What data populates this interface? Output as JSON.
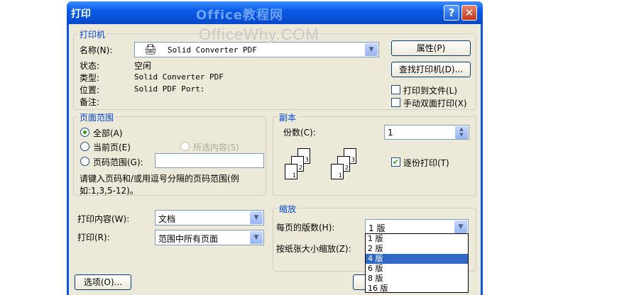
{
  "window": {
    "title": "打印",
    "help": "?",
    "close": "✕"
  },
  "watermark": {
    "top": "Office教程网",
    "bottom": "OfficeWhy.COM"
  },
  "printer": {
    "group_label": "打印机",
    "name_label": "名称(N):",
    "name_value": "Solid Converter PDF",
    "status_label": "状态:",
    "status_value": "空闲",
    "type_label": "类型:",
    "type_value": "Solid Converter PDF",
    "where_label": "位置:",
    "where_value": "Solid PDF Port:",
    "comment_label": "备注:",
    "comment_value": "",
    "properties_button": "属性(P)",
    "find_button": "查找打印机(D)...",
    "print_to_file": "打印到文件(L)",
    "manual_duplex": "手动双面打印(X)"
  },
  "page_range": {
    "group_label": "页面范围",
    "all": "全部(A)",
    "current": "当前页(E)",
    "selection": "所选内容(S)",
    "pages": "页码范围(G):",
    "pages_value": "",
    "hint_line1": "请键入页码和/或用逗号分隔的页码范围(例",
    "hint_line2": "如:1,3,5-12)。"
  },
  "copies": {
    "group_label": "副本",
    "count_label": "份数(C):",
    "count_value": "1",
    "collate": "逐份打印(T)",
    "collate_checked": true
  },
  "print_what": {
    "label": "打印内容(W):",
    "value": "文档"
  },
  "print": {
    "label": "打印(R):",
    "value": "范围中所有页面"
  },
  "zoom": {
    "group_label": "缩放",
    "pages_per_sheet_label": "每页的版数(H):",
    "pages_per_sheet_value": "1 版",
    "scale_label": "按纸张大小缩放(Z):",
    "options": [
      "1 版",
      "2 版",
      "4 版",
      "6 版",
      "8 版",
      "16 版"
    ],
    "selected_index": 2
  },
  "options_button": "选项(O)..."
}
